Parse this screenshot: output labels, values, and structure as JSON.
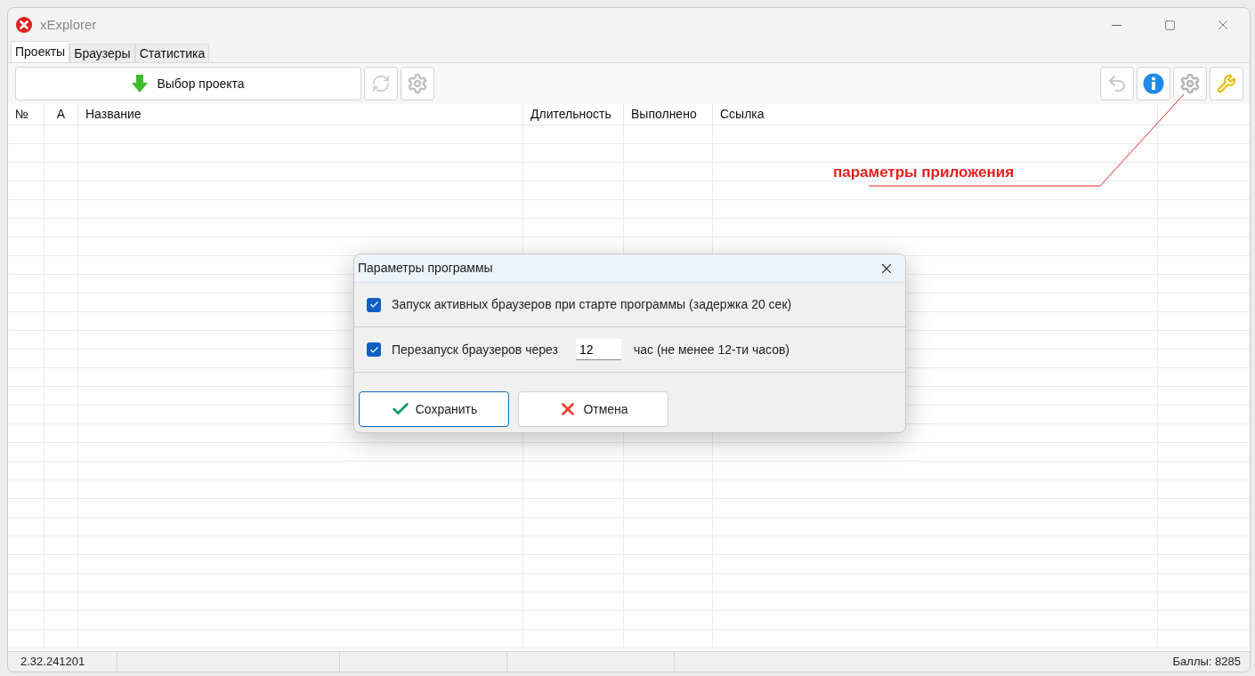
{
  "window": {
    "title": "xExplorer"
  },
  "tabs": [
    {
      "label": "Проекты",
      "selected": true
    },
    {
      "label": "Браузеры",
      "selected": false
    },
    {
      "label": "Статистика",
      "selected": false
    }
  ],
  "toolbar": {
    "main_button": "Выбор проекта"
  },
  "table": {
    "columns": [
      "№",
      "A",
      "Название",
      "Длительность",
      "Выполнено",
      "Ссылка"
    ]
  },
  "annotation": "параметры приложения",
  "dialog": {
    "title": "Параметры программы",
    "options": [
      {
        "kind": "checkbox",
        "label": "Запуск активных браузеров при старте программы (задержка 20 сек)",
        "checked": true
      },
      {
        "kind": "checkbox_with_input",
        "label": "Перезапуск браузеров через",
        "checked": true,
        "value": "12",
        "suffix": "час (не менее 12-ти часов)"
      }
    ],
    "buttons": [
      {
        "kind": "save",
        "label": "Сохранить",
        "selected": true
      },
      {
        "kind": "cancel",
        "label": "Отмена",
        "selected": false
      }
    ]
  },
  "status_bar": {
    "version": "2.32.241201",
    "score": "Баллы: 8285"
  }
}
